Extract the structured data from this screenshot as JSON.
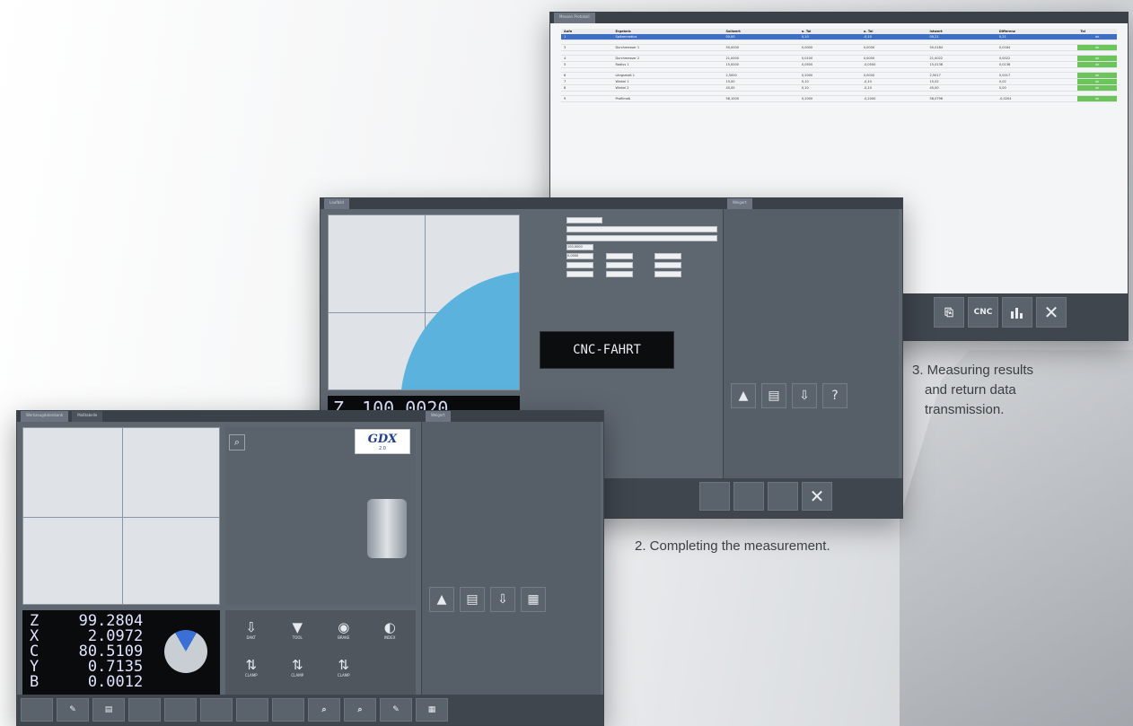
{
  "captions": {
    "step2": "2. Completing the measurement.",
    "step3_line1": "3. Measuring results",
    "step3_line2": "and return data",
    "step3_line3": "transmission."
  },
  "win3": {
    "tab": "Messen Protokoll",
    "columns": [
      "Aufn",
      "Ergebnis",
      "Sollwert",
      "o. Tol",
      "u. Tol",
      "Istwert",
      "Differenz",
      "Tol"
    ],
    "rows": [
      [
        "1",
        "Spitzenradius",
        "00,00",
        "0,10",
        "-0,10",
        "00,21",
        "0,21",
        "ok"
      ],
      [
        "",
        "",
        "",
        "",
        "",
        "",
        "",
        ""
      ],
      [
        "3",
        "Durchmesser 1",
        "50,0000",
        "0,0000",
        "0,0000",
        "50,0184",
        "0,0184",
        "ok"
      ],
      [
        "",
        "",
        "",
        "",
        "",
        "",
        "",
        ""
      ],
      [
        "4",
        "Durchmesser 2",
        "21,0000",
        "0,0100",
        "0,0000",
        "21,0022",
        "0,0022",
        "ok"
      ],
      [
        "5",
        "Radius 1",
        "15,0000",
        "0,0500",
        "-0,0500",
        "15,0136",
        "0,0136",
        "ok"
      ],
      [
        "",
        "",
        "",
        "",
        "",
        "",
        "",
        ""
      ],
      [
        "6",
        "Längsmaß 1",
        "2,5000",
        "0,2000",
        "0,0000",
        "2,5017",
        "0,0017",
        "ok"
      ],
      [
        "7",
        "Winkel 1",
        "15,00",
        "0,10",
        "-0,10",
        "15,02",
        "0,02",
        "ok"
      ],
      [
        "8",
        "Winkel 2",
        "45,00",
        "0,10",
        "-0,10",
        "45,00",
        "0,00",
        "ok"
      ],
      [
        "",
        "",
        "",
        "",
        "",
        "",
        "",
        ""
      ],
      [
        "9",
        "Profilmaß",
        "58,1000",
        "0,2000",
        "-0,2000",
        "58,0796",
        "-0,0204",
        "ok"
      ]
    ],
    "btn_cnc": "CNC",
    "btn_close": "✕"
  },
  "win2": {
    "tab": "Laufbild",
    "panel_tab": "Weigert",
    "cnc_label": "CNC-FAHRT",
    "readout_axis": "Z",
    "readout_value": "100.0020",
    "field_val1": "100,0000",
    "field_val2": "0,0000",
    "btn_close": "✕"
  },
  "win1": {
    "tab1": "Werkzeugdatenbank",
    "tab2": "Maßtabelle",
    "logo_text": "GDX",
    "logo_sub": "2.0",
    "axes": [
      {
        "name": "Z",
        "value": "99.2804"
      },
      {
        "name": "X",
        "value": "2.0972"
      },
      {
        "name": "C",
        "value": "80.5109"
      },
      {
        "name": "Y",
        "value": "0.7135"
      },
      {
        "name": "B",
        "value": "0.0012"
      }
    ],
    "tool_buttons": [
      "DAKT",
      "TOOL",
      "BRAKE",
      "INDEX",
      "CLAMP",
      "CLAMP",
      "CLAMP"
    ],
    "panel_tab": "Weigert"
  },
  "colors": {
    "accent_blue": "#5bb3dd",
    "ok_green": "#6cc55b",
    "selection_blue": "#3f6fc4"
  }
}
